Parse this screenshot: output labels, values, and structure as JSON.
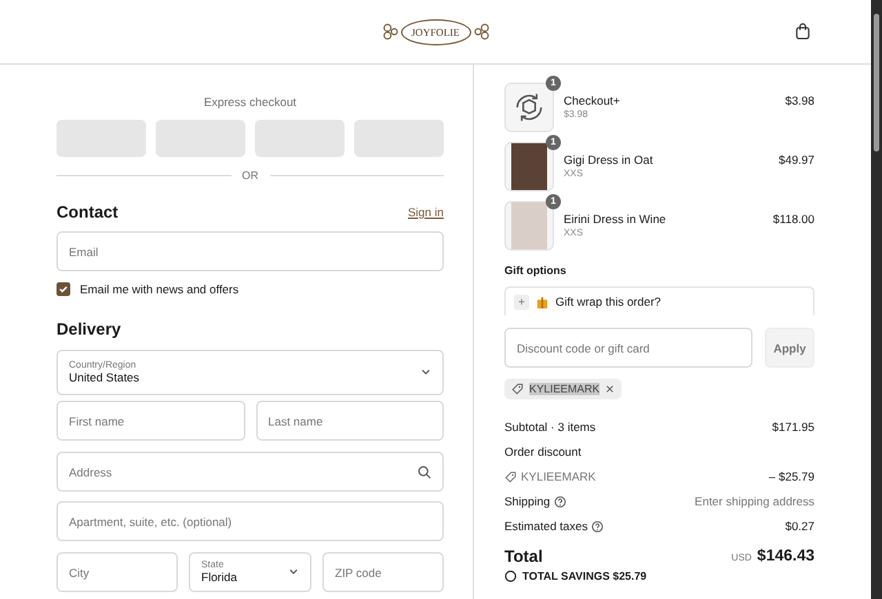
{
  "header": {
    "logo": "JOYFOLIE"
  },
  "express": {
    "title": "Express checkout",
    "divider": "OR"
  },
  "contact": {
    "heading": "Contact",
    "sign_in": "Sign in",
    "email": {
      "placeholder": "Email"
    },
    "newsletter": {
      "label": "Email me with news and offers",
      "checked": true
    }
  },
  "delivery": {
    "heading": "Delivery",
    "country": {
      "label": "Country/Region",
      "value": "United States"
    },
    "first_name": {
      "placeholder": "First name"
    },
    "last_name": {
      "placeholder": "Last name"
    },
    "address": {
      "placeholder": "Address"
    },
    "apartment": {
      "placeholder": "Apartment, suite, etc. (optional)"
    },
    "city": {
      "placeholder": "City"
    },
    "state": {
      "label": "State",
      "value": "Florida"
    },
    "zip": {
      "placeholder": "ZIP code"
    }
  },
  "cart": {
    "items": [
      {
        "kind": "icon",
        "name": "Checkout+",
        "detail": "$3.98",
        "price": "$3.98",
        "quantity": "1"
      },
      {
        "kind": "photo",
        "name": "Gigi Dress in Oat",
        "detail": "XXS",
        "price": "$49.97",
        "quantity": "1"
      },
      {
        "kind": "photo",
        "name": "Eirini Dress in Wine",
        "detail": "XXS",
        "price": "$118.00",
        "quantity": "1"
      }
    ],
    "gift_options": {
      "heading": "Gift options",
      "toggle": "+",
      "label": "Gift wrap this order?"
    },
    "discount": {
      "placeholder": "Discount code or gift card",
      "apply": "Apply",
      "applied_code": "KYLIEEMARK"
    },
    "summary": [
      {
        "kind": "line",
        "label": "Subtotal · 3 items",
        "value": "$171.95"
      },
      {
        "kind": "discount",
        "label": "Order discount",
        "code": "KYLIEEMARK",
        "value": "– $25.79"
      },
      {
        "kind": "help",
        "label": "Shipping",
        "value": "Enter shipping address",
        "muted": true
      },
      {
        "kind": "help",
        "label": "Estimated taxes",
        "value": "$0.27",
        "muted": false
      }
    ],
    "total": {
      "label": "Total",
      "currency": "USD",
      "value": "$146.43"
    },
    "savings": "TOTAL SAVINGS  $25.79"
  }
}
